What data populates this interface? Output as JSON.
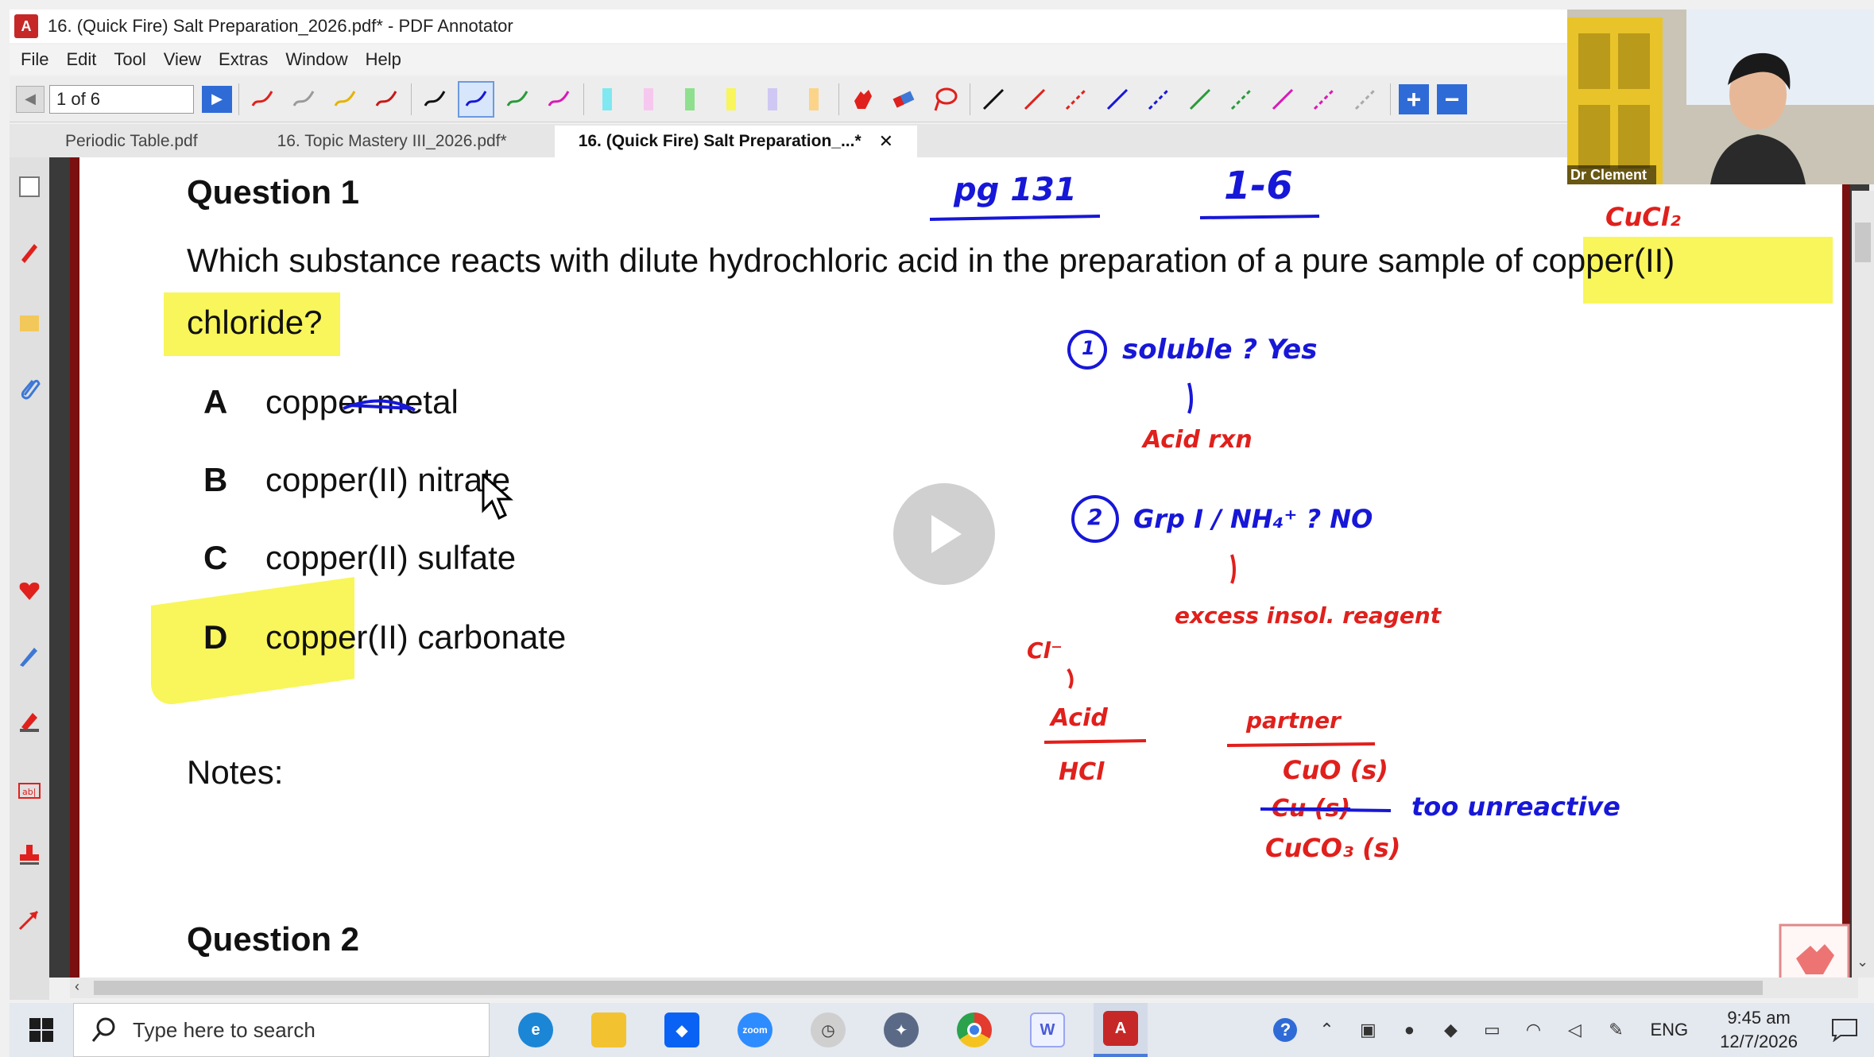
{
  "window": {
    "title": "16. (Quick Fire) Salt Preparation_2026.pdf* - PDF Annotator"
  },
  "menu": [
    "File",
    "Edit",
    "Tool",
    "View",
    "Extras",
    "Window",
    "Help"
  ],
  "toolbar": {
    "page_value": "1 of 6"
  },
  "tabs": [
    {
      "label": "Periodic Table.pdf"
    },
    {
      "label": "16. Topic Mastery III_2026.pdf*"
    },
    {
      "label": "16. (Quick Fire) Salt Preparation_...*",
      "close": "✕"
    }
  ],
  "document": {
    "q1_heading": "Question 1",
    "q1_line1": "Which substance reacts with dilute hydrochloric acid in the preparation of a pure sample of copper(II)",
    "q1_line2": "chloride?",
    "options": [
      {
        "letter": "A",
        "text": "copper metal"
      },
      {
        "letter": "B",
        "text": "copper(II) nitrate"
      },
      {
        "letter": "C",
        "text": "copper(II) sulfate"
      },
      {
        "letter": "D",
        "text": "copper(II) carbonate"
      }
    ],
    "notes_label": "Notes:",
    "q2_heading": "Question 2"
  },
  "handwriting": {
    "pg": "pg 131",
    "range": "1-6",
    "cucl2": "CuCl₂",
    "step1_num": "1",
    "step1_text": "soluble ? Yes",
    "acid_rxn": "Acid rxn",
    "step2_num": "2",
    "step2_text": "Grp I / NH₄⁺ ? NO",
    "excess": "excess insol. reagent",
    "cl_ion": "Cl⁻",
    "acid_label": "Acid",
    "hcl": "HCl",
    "partner_label": "partner",
    "cuo": "CuO (s)",
    "cu_struck": "Cu (s)",
    "too_unreactive": "too unreactive",
    "cuco3": "CuCO₃ (s)"
  },
  "webcam": {
    "name": "Dr Clement"
  },
  "taskbar": {
    "search_placeholder": "Type here to search",
    "lang": "ENG",
    "time": "9:45 am",
    "date": "12/7/2026"
  },
  "colors": {
    "highlight": "#f8f65a",
    "ink_blue": "#1717d8",
    "ink_red": "#e0201c",
    "accent": "#2f6bd6"
  }
}
